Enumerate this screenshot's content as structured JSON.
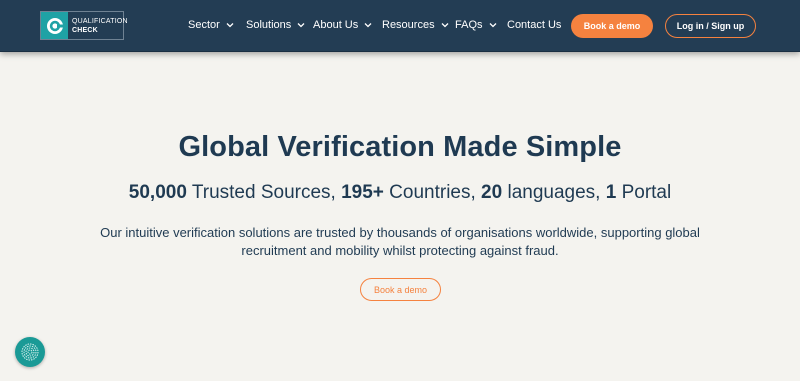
{
  "colors": {
    "header_bg": "#233d54",
    "accent": "#f5823f",
    "brand_teal": "#1fa2a5",
    "page_bg": "#f4f3ef",
    "text": "#1f3a52"
  },
  "logo": {
    "line1": "QUALIFICATION",
    "line2": "CHECK",
    "icon": "qualification-check-logo"
  },
  "nav": {
    "items": [
      {
        "label": "Sector",
        "has_dropdown": true
      },
      {
        "label": "Solutions",
        "has_dropdown": true
      },
      {
        "label": "About Us",
        "has_dropdown": true
      },
      {
        "label": "Resources",
        "has_dropdown": true
      },
      {
        "label": "FAQs",
        "has_dropdown": true
      },
      {
        "label": "Contact Us",
        "has_dropdown": false
      }
    ],
    "book_demo_label": "Book a demo",
    "login_label": "Log in / Sign up"
  },
  "hero": {
    "title": "Global Verification Made Simple",
    "stats": {
      "sources_value": "50,000",
      "sources_label": " Trusted Sources, ",
      "countries_value": "195+",
      "countries_label": " Countries, ",
      "languages_value": "20",
      "languages_label": " languages, ",
      "portal_value": "1",
      "portal_label": " Portal"
    },
    "description": "Our intuitive verification solutions are trusted by thousands of organisations worldwide, supporting global recruitment and mobility whilst protecting against fraud.",
    "cta_label": "Book a demo"
  },
  "widget": {
    "icon": "fingerprint-icon"
  }
}
